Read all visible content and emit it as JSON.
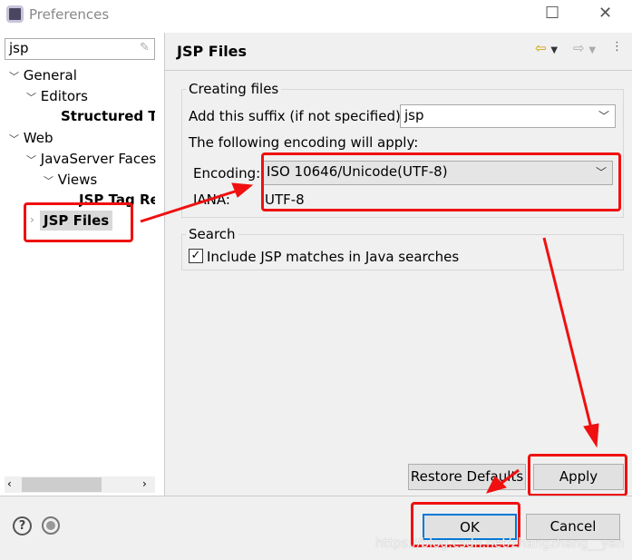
{
  "window": {
    "title": "Preferences"
  },
  "filter": {
    "value": "jsp"
  },
  "tree": [
    {
      "label": "General",
      "expanded": true
    },
    {
      "label": "Editors",
      "expanded": true
    },
    {
      "label": "Structured Te:"
    },
    {
      "label": "Web",
      "expanded": true
    },
    {
      "label": "JavaServer Faces",
      "expanded": true
    },
    {
      "label": "Views",
      "expanded": true
    },
    {
      "label": "JSP Tag Reg"
    },
    {
      "label": "JSP Files",
      "selected": true
    }
  ],
  "page": {
    "title": "JSP Files",
    "creating": {
      "legend": "Creating files",
      "suffix_label": "Add this suffix (if not specified):",
      "suffix_value": "jsp",
      "encoding_note": "The following encoding will apply:",
      "encoding_label": "Encoding:",
      "encoding_value": "ISO 10646/Unicode(UTF-8)",
      "iana_label": "IANA:",
      "iana_value": "UTF-8"
    },
    "search": {
      "legend": "Search",
      "include_label": "Include JSP matches in Java searches",
      "include_checked": true
    },
    "restore_label": "Restore Defaults",
    "apply_label": "Apply"
  },
  "footer": {
    "ok_label": "OK",
    "cancel_label": "Cancel"
  },
  "watermark": "https://blog.csdn.net/zhangzhang__yan",
  "colors": {
    "annotation": "#f01010",
    "ok_border": "#0078d7"
  }
}
